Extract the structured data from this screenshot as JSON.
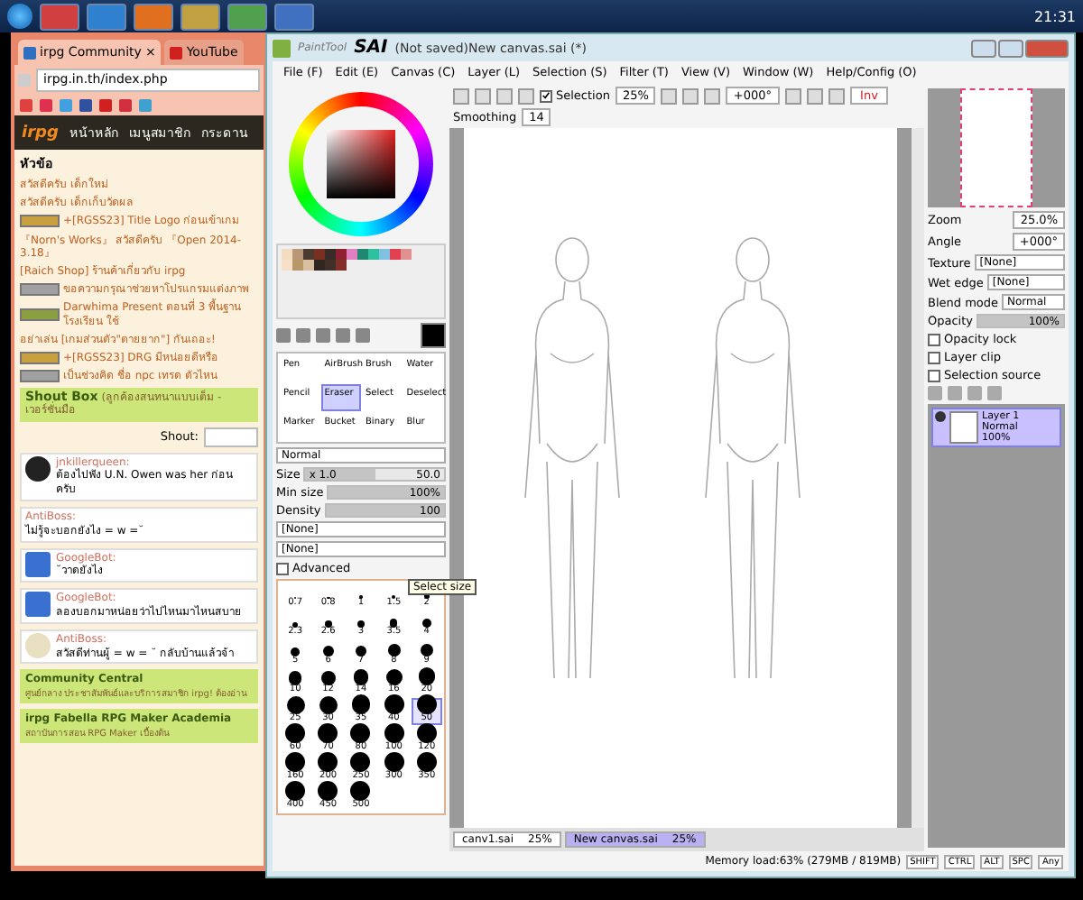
{
  "taskbar": {
    "clock": "21:31"
  },
  "browser": {
    "tabs": [
      {
        "label": "irpg Community",
        "selected": true
      },
      {
        "label": "YouTube",
        "selected": false
      }
    ],
    "tab_close": "×",
    "address": "irpg.in.th/index.php",
    "logo": "irpg",
    "nav": [
      "หน้าหลัก",
      "เมนูสมาชิก",
      "กระดาน"
    ],
    "topics_heading": "หัวข้อ",
    "topics": [
      {
        "text": "สวัสดีครับ เด็กใหม่",
        "kind": "plain"
      },
      {
        "text": "สวัสดีครับ เด็กเก็บวัดผล",
        "kind": "plain"
      },
      {
        "text": "+[RGSS23] Title Logo ก่อนเข้าเกม",
        "kind": "rgss"
      },
      {
        "text": "『Norn's Works』 สวัสดีครับ 『Open 2014- 3.18』",
        "kind": "plain"
      },
      {
        "text": "[Raich Shop] ร้านค้าเกี่ยวกับ irpg",
        "kind": "plain"
      },
      {
        "text": "ขอความกรุณาช่วยหาโปรแกรมแต่งภาพ",
        "kind": "info"
      },
      {
        "text": "Darwhima Present ตอนที่ 3 พื้นฐานโรงเรียน ใช้",
        "kind": "game"
      },
      {
        "text": "อย่าเล่น [เกมส่วนตัว\"ตายยาก\"] กันเถอะ!",
        "kind": "plain"
      },
      {
        "text": "+[RGSS23] DRG มีหน่อยดีหรือ",
        "kind": "rgss"
      },
      {
        "text": "เป็นช่วงคิด ชื่อ npc เทรด ตัวไหน",
        "kind": "info"
      }
    ],
    "shoutbox": {
      "title": "Shout Box",
      "subtitle": "(ลูกค้องสนทนาแบบเต็ม - เวอร์ชั่นมือ",
      "shout_label": "Shout:",
      "messages": [
        {
          "author": "jnkillerqueen:",
          "text": "ต้องไปฟัง U.N. Owen was her ก่อนครับ",
          "kind": "person"
        },
        {
          "author": "AntiBoss:",
          "text": "ไม่รู้จะบอกยังไง = w =˘",
          "kind": "plain"
        },
        {
          "author": "GoogleBot:",
          "text": "˘วาดยังไง",
          "kind": "bot"
        },
        {
          "author": "GoogleBot:",
          "text": "ลองบอกมาหน่อยว่าไปไหนมาไหนสบาย",
          "kind": "bot"
        },
        {
          "author": "AntiBoss:",
          "text": "สวัสดีท่านผู้ = w = ˘ กลับบ้านแล้วจ้า",
          "kind": "emote"
        }
      ]
    },
    "forums": [
      {
        "title": "Community Central",
        "description": "ศูนย์กลาง ประชาสัมพันธ์และบริการสมาชิก irpg! ต้องอ่าน"
      },
      {
        "title": "irpg Fabella RPG Maker Academia",
        "description": "สถาบันการสอน RPG Maker เบื้องต้น"
      }
    ]
  },
  "sai": {
    "app_prefix": "PaintTool",
    "brand": "SAI",
    "title": "(Not saved)New canvas.sai (*)",
    "menu": [
      "File (F)",
      "Edit (E)",
      "Canvas (C)",
      "Layer (L)",
      "Selection (S)",
      "Filter (T)",
      "View (V)",
      "Window (W)",
      "Help/Config (O)"
    ],
    "toolbar": {
      "selection": {
        "label": "Selection",
        "checked": true
      },
      "zoom": "25%",
      "angle": "+000°",
      "invert": "Inv",
      "smoothing_label": "Smoothing",
      "smoothing": "14"
    },
    "swatches": [
      {
        "color": "#f4dcc0"
      },
      {
        "color": "#b89878"
      },
      {
        "color": "#4a3a30"
      },
      {
        "color": "#7a3020"
      },
      {
        "color": "#3a2a28"
      },
      {
        "color": "#902030"
      },
      {
        "color": "#e080c0"
      },
      {
        "color": "#208870"
      },
      {
        "color": "#30c0a0"
      },
      {
        "color": "#80c0e0"
      },
      {
        "color": "#e04050"
      },
      {
        "color": "#e09090"
      },
      {
        "color": "#f6e0c8"
      },
      {
        "color": "#b89868"
      },
      {
        "color": "#d8c0a0"
      },
      {
        "color": "#302820"
      },
      {
        "color": "#403028"
      },
      {
        "color": "#803028"
      }
    ],
    "brushes": [
      {
        "label": "Pen",
        "selected": false
      },
      {
        "label": "AirBrush",
        "selected": false
      },
      {
        "label": "Brush",
        "selected": false
      },
      {
        "label": "Water",
        "selected": false
      },
      {
        "label": "Pencil",
        "selected": false
      },
      {
        "label": "Eraser",
        "selected": true
      },
      {
        "label": "Select",
        "selected": false
      },
      {
        "label": "Deselect",
        "selected": false
      },
      {
        "label": "Marker",
        "selected": false
      },
      {
        "label": "Bucket",
        "selected": false
      },
      {
        "label": "Binary",
        "selected": false
      },
      {
        "label": "Blur",
        "selected": false
      }
    ],
    "blend": "Normal",
    "size": {
      "label": "Size",
      "multiplier": "x 1.0",
      "value": "50.0",
      "level": 0.5
    },
    "min_size": {
      "label": "Min size",
      "value": "100%",
      "level": 1
    },
    "density": {
      "label": "Density",
      "value": "100",
      "level": 1
    },
    "shape": "[None]",
    "brush_texture": "[None]",
    "advanced": {
      "label": "Advanced",
      "checked": false
    },
    "size_options": [
      {
        "label": "0.7",
        "selected": false
      },
      {
        "label": "0.8",
        "selected": false
      },
      {
        "label": "1",
        "selected": false
      },
      {
        "label": "1.5",
        "selected": false
      },
      {
        "label": "2",
        "selected": false
      },
      {
        "label": "2.3",
        "selected": false
      },
      {
        "label": "2.6",
        "selected": false
      },
      {
        "label": "3",
        "selected": false
      },
      {
        "label": "3.5",
        "selected": false
      },
      {
        "label": "4",
        "selected": false
      },
      {
        "label": "5",
        "selected": false
      },
      {
        "label": "6",
        "selected": false
      },
      {
        "label": "7",
        "selected": false
      },
      {
        "label": "8",
        "selected": false
      },
      {
        "label": "9",
        "selected": false
      },
      {
        "label": "10",
        "selected": false
      },
      {
        "label": "12",
        "selected": false
      },
      {
        "label": "14",
        "selected": false
      },
      {
        "label": "16",
        "selected": false
      },
      {
        "label": "20",
        "selected": false
      },
      {
        "label": "25",
        "selected": false
      },
      {
        "label": "30",
        "selected": false
      },
      {
        "label": "35",
        "selected": false
      },
      {
        "label": "40",
        "selected": false
      },
      {
        "label": "50",
        "selected": true
      },
      {
        "label": "60",
        "selected": false
      },
      {
        "label": "70",
        "selected": false
      },
      {
        "label": "80",
        "selected": false
      },
      {
        "label": "100",
        "selected": false
      },
      {
        "label": "120",
        "selected": false
      },
      {
        "label": "160",
        "selected": false
      },
      {
        "label": "200",
        "selected": false
      },
      {
        "label": "250",
        "selected": false
      },
      {
        "label": "300",
        "selected": false
      },
      {
        "label": "350",
        "selected": false
      },
      {
        "label": "400",
        "selected": false
      },
      {
        "label": "450",
        "selected": false
      },
      {
        "label": "500",
        "selected": false
      }
    ],
    "tooltip": "Select size",
    "document_tabs": [
      {
        "name": "canv1.sai",
        "zoom": "25%",
        "selected": false
      },
      {
        "name": "New canvas.sai",
        "zoom": "25%",
        "selected": true
      }
    ],
    "status": {
      "memory": "Memory load:63% (279MB / 819MB)",
      "keys": [
        "SHIFT",
        "CTRL",
        "ALT",
        "SPC",
        "Any"
      ]
    },
    "navigator": {
      "zoom_label": "Zoom",
      "zoom": "25.0%",
      "angle_label": "Angle",
      "angle": "+000°"
    },
    "texture": {
      "label": "Texture",
      "value": "[None]"
    },
    "wet_edge": {
      "label": "Wet edge",
      "value": "[None]"
    },
    "blend_mode": {
      "label": "Blend mode",
      "value": "Normal"
    },
    "opacity": {
      "label": "Opacity",
      "value": "100%",
      "level": 1
    },
    "options": [
      {
        "label": "Opacity lock",
        "checked": false
      },
      {
        "label": "Layer clip",
        "checked": false
      },
      {
        "label": "Selection source",
        "checked": false
      }
    ],
    "layers": [
      {
        "name": "Layer 1",
        "mode": "Normal",
        "opacity": "100%",
        "selected": true,
        "visible": true
      }
    ]
  }
}
